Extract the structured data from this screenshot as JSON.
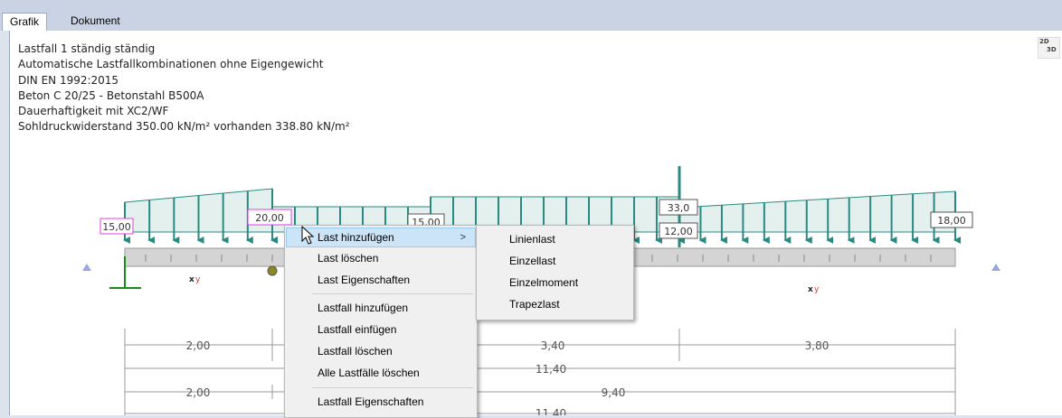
{
  "tabs": [
    {
      "label": "Grafik",
      "active": true
    },
    {
      "label": "Dokument",
      "active": false
    }
  ],
  "info_lines": [
    "Lastfall 1 ständig ständig",
    "Automatische Lastfallkombinationen ohne Eigengewicht",
    "DIN EN 1992:2015",
    "Beton C 20/25 - Betonstahl B500A",
    "Dauerhaftigkeit mit XC2/WF",
    "Sohldruckwiderstand 350.00 kN/m² vorhanden 338.80 kN/m²"
  ],
  "view_toggle": {
    "top": "2D",
    "bottom": "3D"
  },
  "load_labels": {
    "l1": "15,00",
    "l2": "20,00",
    "l3": "15,00",
    "l4": "33,0",
    "l5": "12,00",
    "l6": "18,00"
  },
  "dimensions": {
    "row1": [
      "2,00",
      "3,40",
      "3,80"
    ],
    "row2": "11,40",
    "row3": [
      "2,00",
      "9,40"
    ],
    "row4": "11,40"
  },
  "context_menu": {
    "items": [
      {
        "label": "Last hinzufügen",
        "has_submenu": true,
        "highlighted": true
      },
      {
        "label": "Last löschen"
      },
      {
        "label": "Last Eigenschaften"
      },
      {
        "label": "Lastfall hinzufügen"
      },
      {
        "label": "Lastfall einfügen"
      },
      {
        "label": "Lastfall löschen"
      },
      {
        "label": "Alle Lastfälle löschen"
      },
      {
        "label": "Lastfall Eigenschaften"
      }
    ],
    "submenu_arrow": ">"
  },
  "submenu": {
    "items": [
      "Linienlast",
      "Einzellast",
      "Einzelmoment",
      "Trapezlast"
    ]
  },
  "colors": {
    "load_fill": "#e4f0ee",
    "load_arrow": "#2a8a82",
    "highlight_label": "#e040e0",
    "beam": "#d4d4d4"
  }
}
